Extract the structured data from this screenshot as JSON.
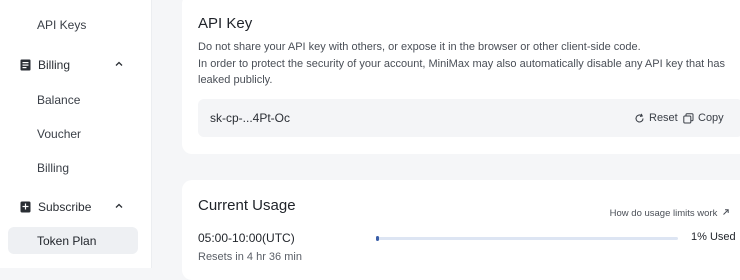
{
  "sidebar": {
    "api_keys": "API Keys",
    "billing_group": "Billing",
    "balance": "Balance",
    "voucher": "Voucher",
    "billing": "Billing",
    "subscribe_group": "Subscribe",
    "token_plan": "Token Plan"
  },
  "api_key_card": {
    "title": "API Key",
    "line1": "Do not share your API key with others, or expose it in the browser or other client-side code.",
    "line2": "In order to protect the security of your account, MiniMax may also automatically disable any API key that has leaked publicly.",
    "key_value": "sk-cp-...4Pt-Oc",
    "reset_label": "Reset",
    "copy_label": "Copy"
  },
  "usage_card": {
    "title": "Current Usage",
    "help_link": "How do usage limits work",
    "time_window": "05:00-10:00(UTC)",
    "resets_text": "Resets in 4 hr 36 min",
    "used_label": "1% Used",
    "used_fraction": 0.01
  },
  "colors": {
    "progress_fill": "#3a5ea8",
    "progress_track": "#dde5f3",
    "active_bg": "#eef0f3"
  }
}
